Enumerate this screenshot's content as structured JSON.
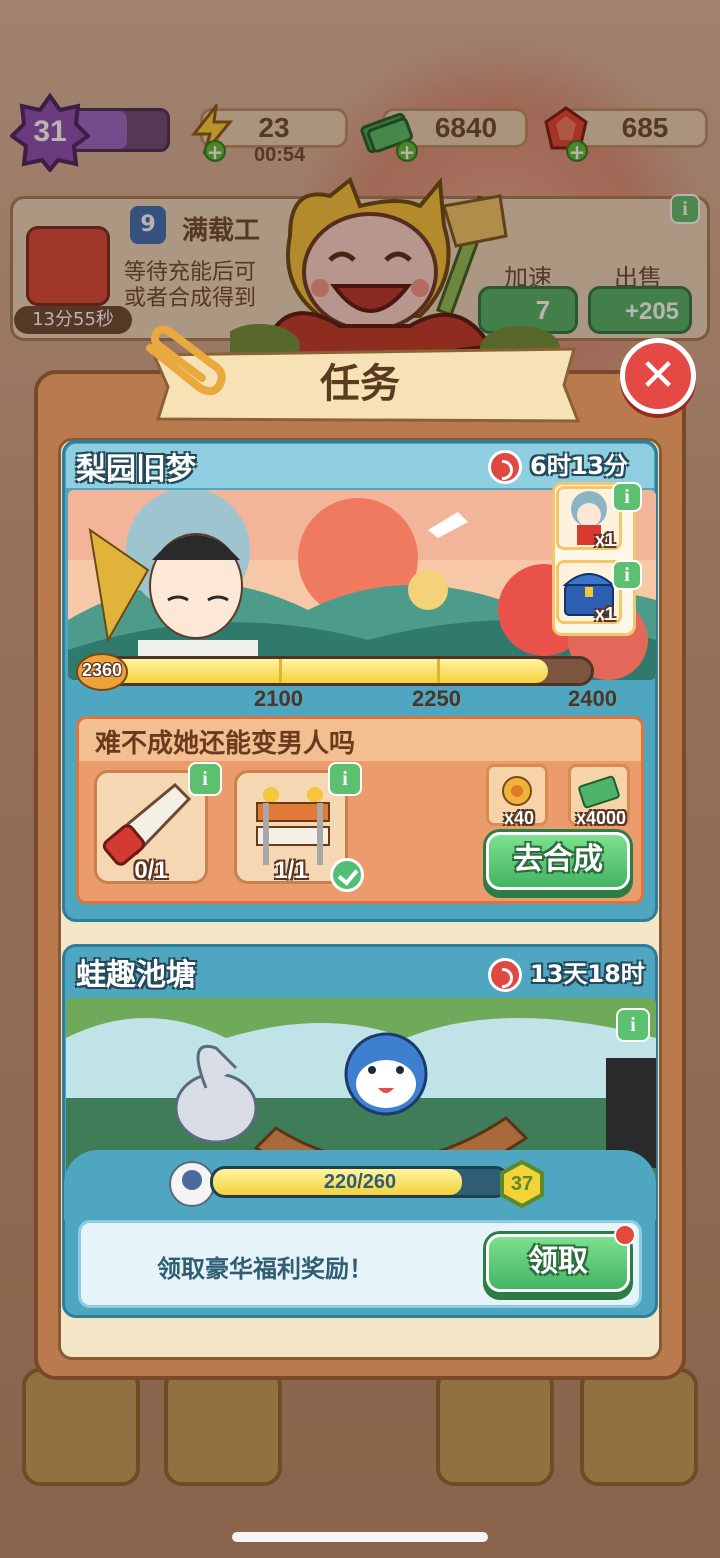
{
  "hud": {
    "level": "31",
    "energy": "23",
    "energy_timer": "00:54",
    "cash": "6840",
    "gems": "685"
  },
  "background_task": {
    "level": "9",
    "title": "满载工",
    "line1": "等待充能后可",
    "line2": "或者合成得到",
    "suffix": "。",
    "timer": "13分55秒",
    "speedup_label": "加速",
    "sell_label": "出售",
    "speedup_cost": "7",
    "sell_value": "+205"
  },
  "modal": {
    "title": "任务"
  },
  "event1": {
    "title": "梨园旧梦",
    "timer": "6时13分",
    "current_points": "2360",
    "progress": {
      "current": 2360,
      "max": 2400,
      "ticks": [
        2100,
        2250,
        2400
      ]
    },
    "tick_labels": [
      "2100",
      "2250",
      "2400"
    ],
    "side_rewards": [
      {
        "count": "x1"
      },
      {
        "count": "x1"
      }
    ],
    "quest": {
      "title": "难不成她还能变男人吗",
      "requirements": [
        {
          "count": "0/1"
        },
        {
          "count": "1/1"
        }
      ],
      "rewards": [
        {
          "count": "x40"
        },
        {
          "count": "x4000"
        }
      ],
      "button": "去合成"
    }
  },
  "event2": {
    "title": "蛙趣池塘",
    "timer": "13天18时",
    "progress_text": "220/260",
    "progress": {
      "current": 220,
      "max": 260
    },
    "level": "37",
    "claim_text": "领取豪华福利奖励！",
    "claim_button": "领取"
  },
  "colors": {
    "panel_blue": "#4ea6c0",
    "quest_orange": "#ec9c6c",
    "green_button": "#43b463",
    "close_red": "#e54944",
    "progress_yellow": "#f4d23a"
  },
  "icons": [
    "level-star-icon",
    "energy-icon",
    "cash-icon",
    "gem-icon",
    "clock-icon",
    "info-icon",
    "close-icon",
    "saw-icon",
    "roadblock-icon",
    "check-icon",
    "flower-coin-icon",
    "cash-stack-icon",
    "opera-doll-icon",
    "treasure-chest-icon",
    "egg-bird-icon",
    "back-arrow-icon",
    "inventory-icon",
    "basket-icon",
    "star-icon"
  ]
}
